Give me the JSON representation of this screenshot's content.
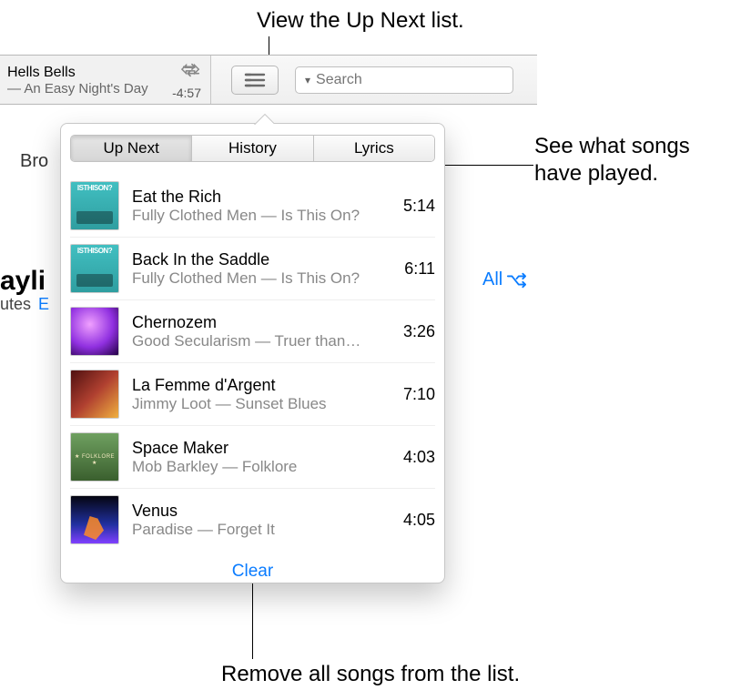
{
  "callouts": {
    "top": "View the Up Next list.",
    "right": "See what songs\nhave played.",
    "bottom": "Remove all songs from the list."
  },
  "toolbar": {
    "now_playing_title": "Hells Bells",
    "now_playing_sub": " — An Easy Night's Day",
    "remaining_time": "-4:57",
    "search_placeholder": "Search"
  },
  "background": {
    "browse": "Bro",
    "playlist_big": "ayli",
    "utes": "utes",
    "e_link": "E",
    "all": "All"
  },
  "popover": {
    "tabs": {
      "upnext": "Up Next",
      "history": "History",
      "lyrics": "Lyrics"
    },
    "items": [
      {
        "title": "Eat the Rich",
        "sub": "Fully Clothed Men — Is This On?",
        "dur": "5:14",
        "art_label": "ISTHISON?"
      },
      {
        "title": "Back In the Saddle",
        "sub": "Fully Clothed Men — Is This On?",
        "dur": "6:11",
        "art_label": "ISTHISON?"
      },
      {
        "title": "Chernozem",
        "sub": "Good Secularism — Truer than…",
        "dur": "3:26",
        "art_label": ""
      },
      {
        "title": "La Femme d'Argent",
        "sub": "Jimmy Loot — Sunset Blues",
        "dur": "7:10",
        "art_label": ""
      },
      {
        "title": "Space Maker",
        "sub": "Mob Barkley — Folklore",
        "dur": "4:03",
        "art_label": ""
      },
      {
        "title": "Venus",
        "sub": "Paradise — Forget It",
        "dur": "4:05",
        "art_label": ""
      }
    ],
    "clear_label": "Clear"
  }
}
